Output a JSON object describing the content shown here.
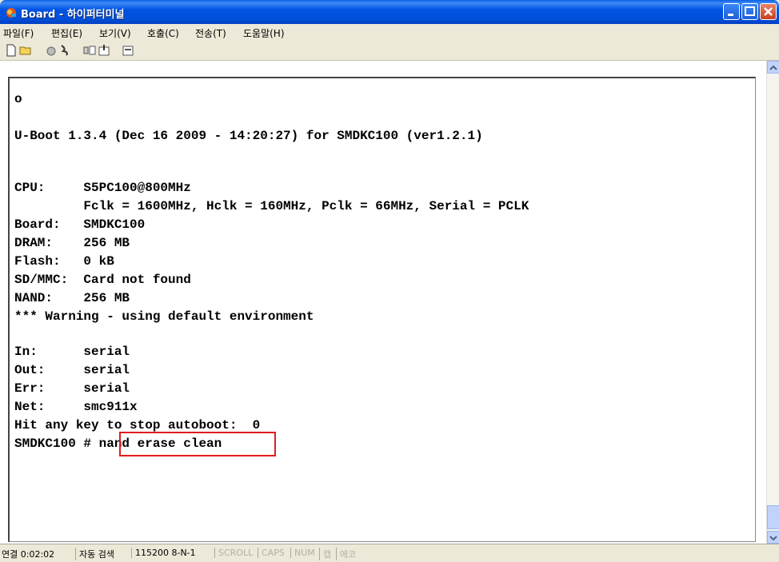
{
  "window": {
    "title": "Board - 하이퍼터미널"
  },
  "menu": [
    {
      "label": "파일(F)"
    },
    {
      "label": "편집(E)"
    },
    {
      "label": "보기(V)"
    },
    {
      "label": "호출(C)"
    },
    {
      "label": "전송(T)"
    },
    {
      "label": "도움말(H)"
    }
  ],
  "terminal": {
    "lines": [
      "o",
      "",
      "U-Boot 1.3.4 (Dec 16 2009 - 14:20:27) for SMDKC100 (ver1.2.1)",
      "",
      "",
      "CPU:     S5PC100@800MHz",
      "         Fclk = 1600MHz, Hclk = 160MHz, Pclk = 66MHz, Serial = PCLK",
      "Board:   SMDKC100",
      "DRAM:    256 MB",
      "Flash:   0 kB",
      "SD/MMC:  Card not found",
      "NAND:    256 MB",
      "*** Warning - using default environment",
      "",
      "In:      serial",
      "Out:     serial",
      "Err:     serial",
      "Net:     smc911x",
      "Hit any key to stop autoboot:  0",
      "SMDKC100 # nand erase clean"
    ]
  },
  "status": {
    "connected": "연결 0:02:02",
    "detect": "자동 검색",
    "port": "115200 8-N-1",
    "scroll": "SCROLL",
    "caps": "CAPS",
    "num": "NUM",
    "capture": "캡",
    "echo": "에코"
  }
}
